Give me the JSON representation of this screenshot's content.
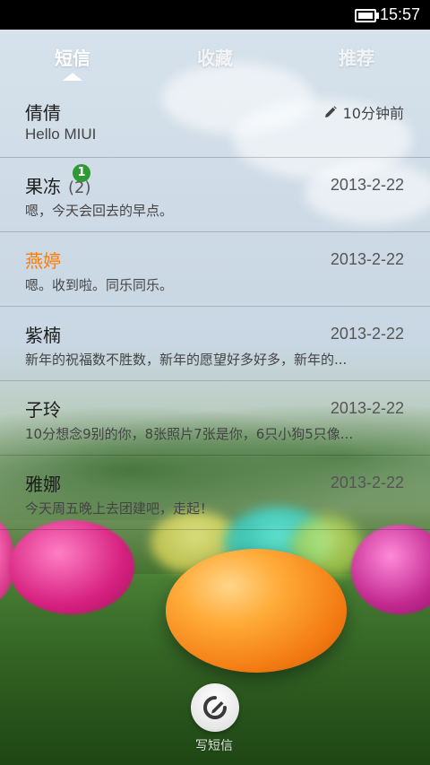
{
  "status_bar": {
    "time": "15:57",
    "battery_icon": "battery-full-icon"
  },
  "tabs": [
    {
      "label": "短信",
      "active": true
    },
    {
      "label": "收藏",
      "active": false
    },
    {
      "label": "推荐",
      "active": false
    }
  ],
  "conversations": [
    {
      "name": "倩倩",
      "count": "",
      "time": "10分钟前",
      "preview": "Hello MIUI",
      "draft_icon": "pencil-icon"
    },
    {
      "name": "果冻",
      "count": "(2)",
      "time": "2013-2-22",
      "preview": "嗯，今天会回去的早点。"
    },
    {
      "name": "燕婷",
      "count": "",
      "unread": "1",
      "time": "2013-2-22",
      "preview": "嗯。收到啦。同乐同乐。",
      "name_color": "#ff7a00"
    },
    {
      "name": "紫楠",
      "count": "",
      "time": "2013-2-22",
      "preview": "新年的祝福数不胜数，新年的愿望好多好多，新年的..."
    },
    {
      "name": "子玲",
      "count": "",
      "time": "2013-2-22",
      "preview": "10分想念9别的你，8张照片7张是你，6只小狗5只像..."
    },
    {
      "name": "雅娜",
      "count": "",
      "time": "2013-2-22",
      "preview": "今天周五晚上去团建吧，走起！"
    }
  ],
  "compose": {
    "label": "写短信",
    "icon": "compose-icon"
  },
  "colors": {
    "unread_badge": "#2e9a33",
    "highlight_name": "#ff7a00"
  }
}
